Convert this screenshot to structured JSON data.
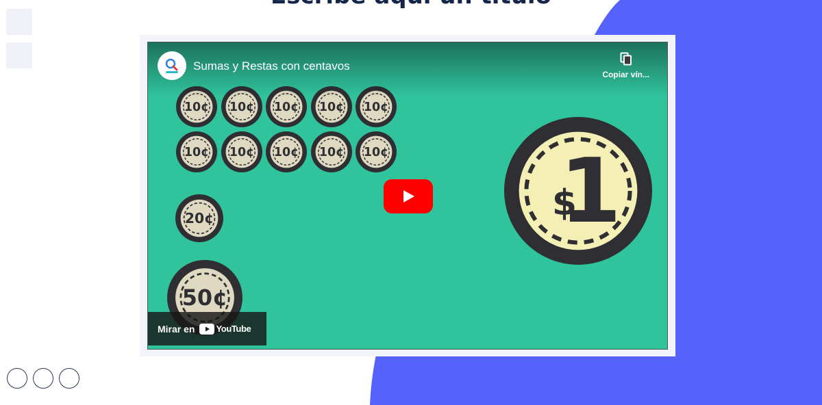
{
  "page": {
    "title": "Escribe aquí un título",
    "colors": {
      "accent_blob": "#5562fb",
      "title": "#14264a",
      "side_square": "#eef1f8"
    }
  },
  "embed": {
    "video_title": "Sumas y Restas con centavos",
    "copy_link_label": "Copiar vín...",
    "watch_on_label": "Mirar en",
    "youtube_wordmark": "YouTube",
    "colors": {
      "video_bg": "#30c49d",
      "play_red": "#ff0000",
      "coin_dark": "#2f2f33",
      "coin_face": "#e0d9c1",
      "dollar_face": "#f4efb5"
    }
  },
  "coins": {
    "ten_label": "10¢",
    "twenty_label": "20¢",
    "fifty_label": "50¢",
    "dollar_label": "$1",
    "ten_count": 10
  },
  "pagination": {
    "dot_count": 3
  }
}
